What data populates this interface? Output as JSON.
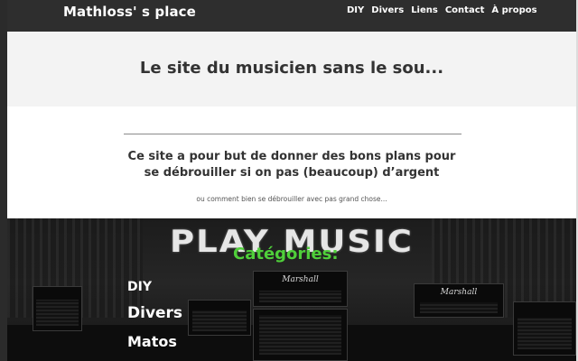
{
  "site": {
    "brand": "Mathloss' s place"
  },
  "nav": {
    "items": [
      {
        "label": "DIY"
      },
      {
        "label": "Divers"
      },
      {
        "label": "Liens"
      },
      {
        "label": "Contact"
      },
      {
        "label": "À propos"
      }
    ]
  },
  "hero": {
    "title": "Le site du musicien sans le sou..."
  },
  "intro": {
    "line1": "Ce site a pour but de donner des bons plans pour",
    "line2": "se débrouiller si on pas (beaucoup) d’argent",
    "subtitle": "ou comment bien se débrouiller avec pas grand chose..."
  },
  "banner": {
    "logo_text": "PLAY MUSIC",
    "amp_brand": "Marshall",
    "categories_title": "Catégories:",
    "categories": [
      {
        "label": "DIY"
      },
      {
        "label": "Divers"
      },
      {
        "label": "Matos"
      }
    ]
  },
  "colors": {
    "navbar": "#2e2e2e",
    "hero_bg": "#f3f3f3",
    "accent_green": "#4fcf3a",
    "text_dark": "#333333"
  }
}
